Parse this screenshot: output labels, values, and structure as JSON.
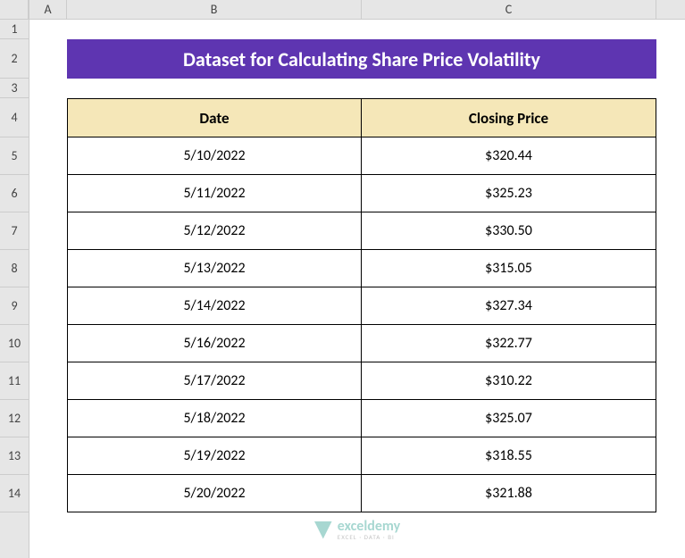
{
  "columns": [
    "A",
    "B",
    "C"
  ],
  "rows": [
    "1",
    "2",
    "3",
    "4",
    "5",
    "6",
    "7",
    "8",
    "9",
    "10",
    "11",
    "12",
    "13",
    "14"
  ],
  "title": "Dataset for Calculating Share Price Volatility",
  "headers": {
    "date": "Date",
    "price": "Closing Price"
  },
  "data": [
    {
      "date": "5/10/2022",
      "price": "$320.44"
    },
    {
      "date": "5/11/2022",
      "price": "$325.23"
    },
    {
      "date": "5/12/2022",
      "price": "$330.50"
    },
    {
      "date": "5/13/2022",
      "price": "$315.05"
    },
    {
      "date": "5/14/2022",
      "price": "$327.34"
    },
    {
      "date": "5/16/2022",
      "price": "$322.77"
    },
    {
      "date": "5/17/2022",
      "price": "$310.22"
    },
    {
      "date": "5/18/2022",
      "price": "$325.07"
    },
    {
      "date": "5/19/2022",
      "price": "$318.55"
    },
    {
      "date": "5/20/2022",
      "price": "$321.88"
    }
  ],
  "watermark": {
    "main": "exceldemy",
    "sub": "EXCEL · DATA · BI"
  }
}
